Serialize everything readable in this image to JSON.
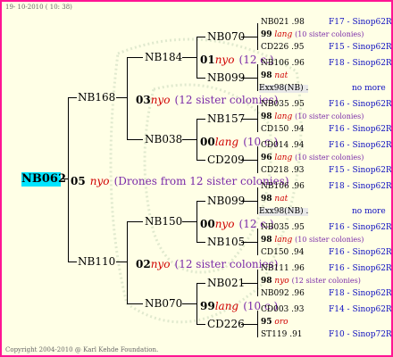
{
  "header": "19- 10-2010 ( 10: 38)",
  "footer": "Copyright 2004-2010 @ Karl Kehde Foundation.",
  "root": "NB062",
  "root_info": {
    "year": "05",
    "race": "nyo",
    "desc": "(Drones from 12 sister colonies)"
  },
  "g1": [
    {
      "name": "NB168",
      "year": "03",
      "race": "nyo",
      "desc": "(12 sister colonies)"
    },
    {
      "name": "NB110",
      "year": "02",
      "race": "nyo",
      "desc": "(12 sister colonies)"
    }
  ],
  "g2": [
    {
      "name": "NB184",
      "year": "01",
      "race": "nyo",
      "desc": "(12 c.)"
    },
    {
      "name": "NB038",
      "year": "00",
      "race": "lang",
      "desc": "(10 c.)"
    },
    {
      "name": "NB150",
      "year": "00",
      "race": "nyo",
      "desc": "(12 c.)"
    },
    {
      "name": "NB070",
      "year": "99",
      "race": "lang",
      "desc": "(10 c.)"
    }
  ],
  "g3": [
    "NB070",
    "NB099",
    "NB157",
    "CD209",
    "NB099",
    "NB105",
    "NB021",
    "CD226"
  ],
  "g4": [
    {
      "top": "NB021 .98",
      "top_lic": "F17 - Sinop62R",
      "mid_year": "99",
      "mid_race": "lang",
      "mid_desc": "(10 sister colonies)",
      "bot": "CD226 .95",
      "bot_lic": "F15 - Sinop62R"
    },
    {
      "top": "NB106 .96",
      "top_lic": "F18 - Sinop62R",
      "mid_year": "98",
      "mid_race": "nat",
      "mid_desc": "",
      "bot": "Exx98(NB) .",
      "bot_lic": "no more"
    },
    {
      "top": "NB035 .95",
      "top_lic": "F16 - Sinop62R",
      "mid_year": "98",
      "mid_race": "lang",
      "mid_desc": "(10 sister colonies)",
      "bot": "CD150 .94",
      "bot_lic": "F16 - Sinop62R"
    },
    {
      "top": "CD014 .94",
      "top_lic": "F16 - Sinop62R",
      "mid_year": "96",
      "mid_race": "lang",
      "mid_desc": "(10 sister colonies)",
      "bot": "CD218 .93",
      "bot_lic": "F15 - Sinop62R"
    },
    {
      "top": "NB106 .96",
      "top_lic": "F18 - Sinop62R",
      "mid_year": "98",
      "mid_race": "nat",
      "mid_desc": "",
      "bot": "Exx98(NB) .",
      "bot_lic": "no more"
    },
    {
      "top": "NB035 .95",
      "top_lic": "F16 - Sinop62R",
      "mid_year": "98",
      "mid_race": "lang",
      "mid_desc": "(10 sister colonies)",
      "bot": "CD150 .94",
      "bot_lic": "F16 - Sinop62R"
    },
    {
      "top": "NB111 .96",
      "top_lic": "F16 - Sinop62R",
      "mid_year": "98",
      "mid_race": "nyo",
      "mid_desc": "(12 sister colonies)",
      "bot": "NB092 .96",
      "bot_lic": "F18 - Sinop62R"
    },
    {
      "top": "CD003 .93",
      "top_lic": "F14 - Sinop62R",
      "mid_year": "95",
      "mid_race": "oro",
      "mid_desc": "",
      "bot": "ST119 .91",
      "bot_lic": "F10 - Sinop72R"
    }
  ]
}
